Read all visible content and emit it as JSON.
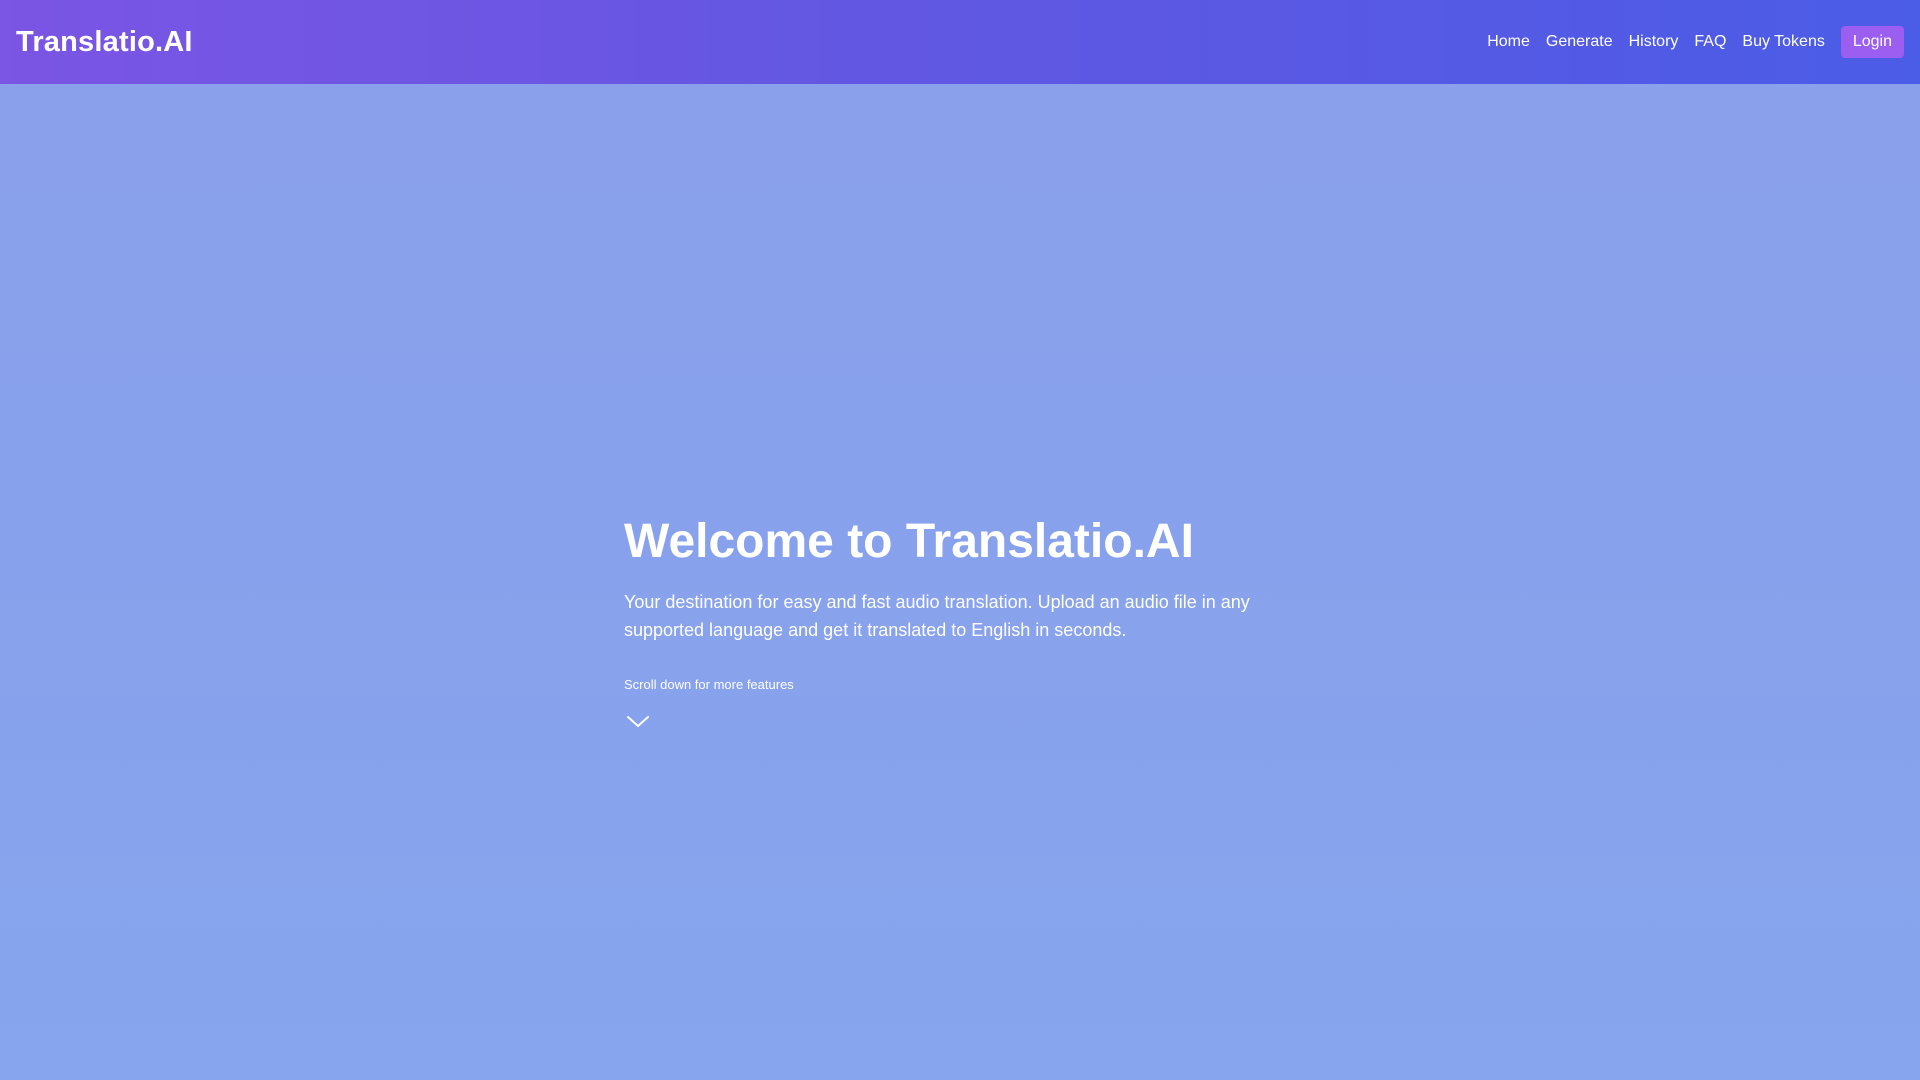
{
  "navbar": {
    "brand": "Translatio.AI",
    "links": [
      "Home",
      "Generate",
      "History",
      "FAQ",
      "Buy Tokens"
    ],
    "login_label": "Login"
  },
  "hero": {
    "title": "Welcome to Translatio.AI",
    "subtitle": "Your destination for easy and fast audio translation. Upload an audio file in any supported language and get it translated to English in seconds.",
    "scroll_hint": "Scroll down for more features",
    "scroll_icon": "chevron-down-icon"
  },
  "colors": {
    "navbar_start": "#7b55e4",
    "navbar_end": "#4b5ce6",
    "background": "#88a1ec",
    "login_button": "#9b5ef0",
    "text": "#ffffff"
  }
}
